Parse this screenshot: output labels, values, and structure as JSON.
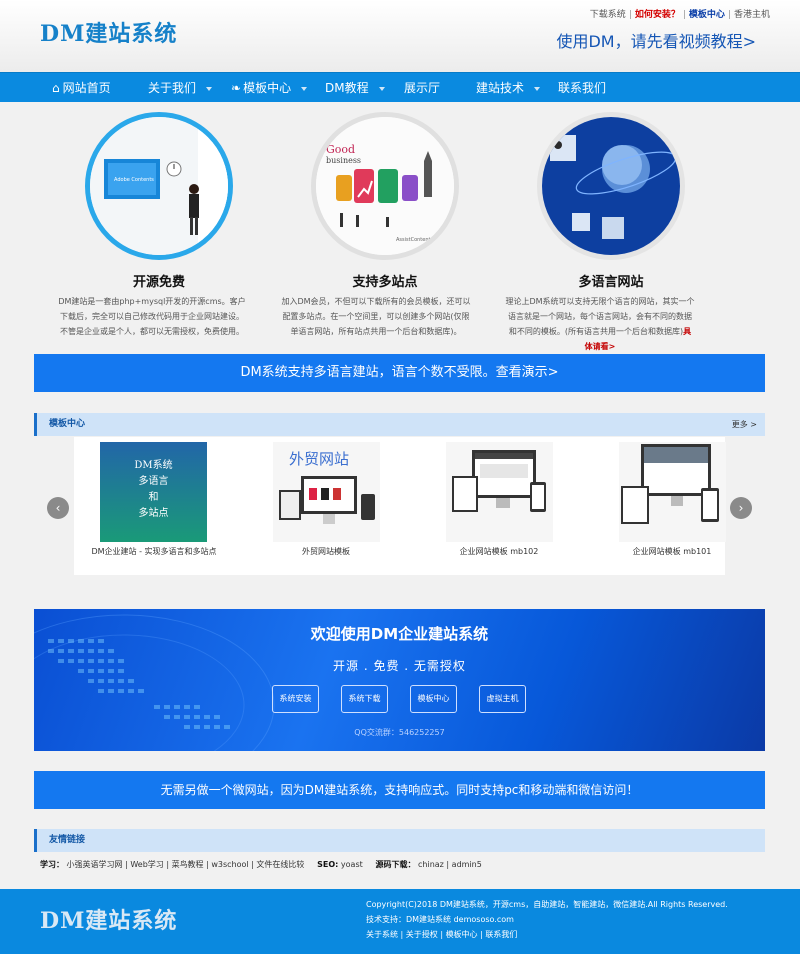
{
  "header": {
    "logo": "DM建站系统",
    "top_links": [
      "下载系统",
      "如何安装？",
      "模板中心",
      "香港主机"
    ],
    "slogan": "使用DM，请先看视频教程>"
  },
  "nav": {
    "items": [
      "网站首页",
      "关于我们",
      "模板中心",
      "DM教程",
      "展示厅",
      "建站技术",
      "联系我们"
    ]
  },
  "features": [
    {
      "title": "开源免费",
      "desc": "DM建站是一套由php+mysql开发的开源cms。客户下载后，完全可以自己修改代码用于企业网站建设。不管是企业或是个人，都可以无需授权，免费使用。"
    },
    {
      "title": "支持多站点",
      "desc": "加入DM会员，不但可以下载所有的会员模板，还可以配置多站点。在一个空间里，可以创建多个网站(仅限单语言网站，所有站点共用一个后台和数据库)。"
    },
    {
      "title": "多语言网站",
      "desc": "理论上DM系统可以支持无限个语言的网站，其实一个语言就是一个网站，每个语言网站，会有不同的数据和不同的模板。(所有语言共用一个后台和数据库)",
      "more": "具体请看>"
    }
  ],
  "feature_images": [
    {
      "screen_title": "Adobe Contents"
    },
    {
      "word1": "Good",
      "word2": "business",
      "small": "AssistContent"
    },
    {}
  ],
  "lang_banner": "DM系统支持多语言建站，语言个数不受限。查看演示>",
  "templates": {
    "title": "模板中心",
    "more": "更多 >",
    "items": [
      {
        "caption": "DM企业建站 - 实现多语言和多站点",
        "thumb_text": [
          "DM系统",
          "多语言",
          "和",
          "多站点"
        ]
      },
      {
        "caption": "外贸网站模板",
        "thumb_text": [
          "外贸网站"
        ]
      },
      {
        "caption": "企业网站模板 mb102"
      },
      {
        "caption": "企业网站模板 mb101"
      }
    ]
  },
  "welcome": {
    "title": "欢迎使用DM企业建站系统",
    "subtitle": "开源 . 免费 . 无需授权",
    "buttons": [
      "系统安装",
      "系统下载",
      "模板中心",
      "虚拟主机"
    ],
    "qq": "QQ交流群：546252257"
  },
  "mobile_banner": "无需另做一个微网站，因为DM建站系统，支持响应式。同时支持pc和移动端和微信访问！",
  "friend_links": {
    "title": "友情链接",
    "groups": [
      {
        "label": "学习：",
        "links": [
          "小强英语学习网",
          "Web学习",
          "菜鸟教程",
          "w3school",
          "文件在线比较"
        ]
      },
      {
        "label": "SEO:",
        "links": [
          "yoast"
        ]
      },
      {
        "label": "源码下载：",
        "links": [
          "chinaz",
          "admin5"
        ]
      }
    ]
  },
  "footer": {
    "logo": "DM建站系统",
    "copyright": "Copyright(C)2018 DM建站系统，开源cms，自助建站，智能建站，微信建站.All Rights Reserved.",
    "support": "技术支持：DM建站系统 demososo.com",
    "links": [
      "关于系统",
      "关于授权",
      "模板中心",
      "联系我们"
    ]
  },
  "colors": {
    "primary": "#1478f0",
    "nav": "#0a8ae0",
    "accent_red": "#c40000"
  }
}
